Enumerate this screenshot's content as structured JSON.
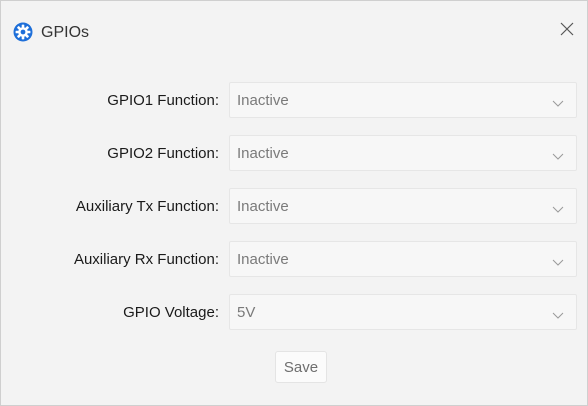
{
  "window": {
    "title": "GPIOs",
    "app_icon": "gear-icon",
    "close_icon": "close-icon",
    "accent_color": "#1e88e5"
  },
  "form": {
    "fields": [
      {
        "label": "GPIO1 Function:",
        "value": "Inactive"
      },
      {
        "label": "GPIO2 Function:",
        "value": "Inactive"
      },
      {
        "label": "Auxiliary Tx Function:",
        "value": "Inactive"
      },
      {
        "label": "Auxiliary Rx Function:",
        "value": "Inactive"
      },
      {
        "label": "GPIO Voltage:",
        "value": "5V"
      }
    ],
    "save_label": "Save"
  }
}
